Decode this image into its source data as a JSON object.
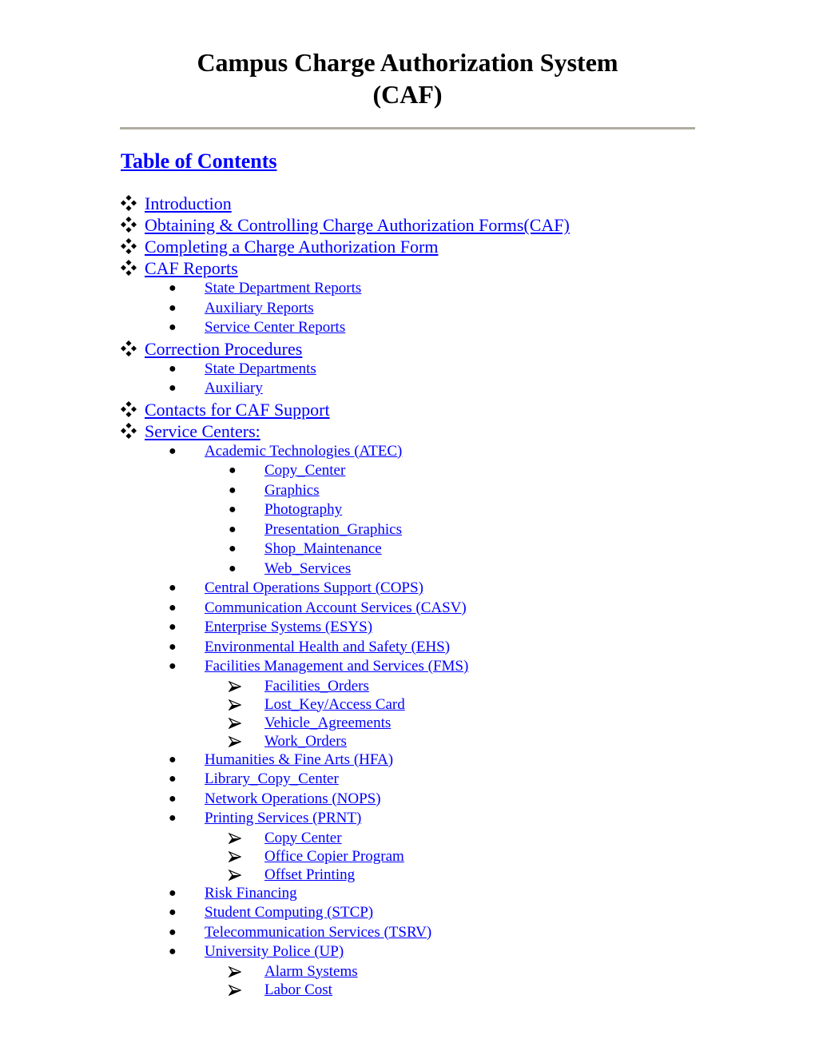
{
  "document": {
    "title_line1": "Campus Charge Authorization System",
    "title_line2": "(CAF)",
    "toc_heading": "Table of Contents"
  },
  "toc": [
    {
      "level": 0,
      "marker": "diamond-bullet",
      "label": "Introduction"
    },
    {
      "level": 0,
      "marker": "diamond-bullet",
      "label": "Obtaining & Controlling Charge Authorization Forms(CAF)"
    },
    {
      "level": 0,
      "marker": "diamond-bullet",
      "label": "Completing a Charge Authorization Form"
    },
    {
      "level": 0,
      "marker": "diamond-bullet",
      "label": "CAF Reports"
    },
    {
      "level": 1,
      "marker": "dot-bullet",
      "label": "State Department Reports"
    },
    {
      "level": 1,
      "marker": "dot-bullet",
      "label": "Auxiliary Reports"
    },
    {
      "level": 1,
      "marker": "dot-bullet",
      "label": "Service Center Reports"
    },
    {
      "level": 0,
      "marker": "diamond-bullet",
      "label": "Correction Procedures"
    },
    {
      "level": 1,
      "marker": "dot-bullet",
      "label": "State Departments"
    },
    {
      "level": 1,
      "marker": "dot-bullet",
      "label": "Auxiliary"
    },
    {
      "level": 0,
      "marker": "diamond-bullet",
      "label": "Contacts for CAF Support"
    },
    {
      "level": 0,
      "marker": "diamond-bullet",
      "label": "Service Centers:"
    },
    {
      "level": 1,
      "marker": "dot-bullet",
      "label": "Academic Technologies (ATEC)"
    },
    {
      "level": 2,
      "marker": "dot-bullet",
      "label": "Copy_Center"
    },
    {
      "level": 2,
      "marker": "dot-bullet",
      "label": "Graphics"
    },
    {
      "level": 2,
      "marker": "dot-bullet",
      "label": "Photography"
    },
    {
      "level": 2,
      "marker": "dot-bullet",
      "label": "Presentation_Graphics"
    },
    {
      "level": 2,
      "marker": "dot-bullet",
      "label": "Shop_Maintenance"
    },
    {
      "level": 2,
      "marker": "dot-bullet",
      "label": "Web_Services"
    },
    {
      "level": 1,
      "marker": "dot-bullet",
      "label": "Central Operations Support (COPS)"
    },
    {
      "level": 1,
      "marker": "dot-bullet",
      "label": "Communication Account Services (CASV)"
    },
    {
      "level": 1,
      "marker": "dot-bullet",
      "label": "Enterprise Systems (ESYS) "
    },
    {
      "level": 1,
      "marker": "dot-bullet",
      "label": "Environmental Health and Safety (EHS)"
    },
    {
      "level": 1,
      "marker": "dot-bullet",
      "label": "Facilities Management and Services (FMS)"
    },
    {
      "level": 3,
      "marker": "arrow-bullet",
      "label": "Facilities_Orders"
    },
    {
      "level": 3,
      "marker": "arrow-bullet",
      "label": "Lost_Key/Access Card"
    },
    {
      "level": 3,
      "marker": "arrow-bullet",
      "label": "Vehicle_Agreements"
    },
    {
      "level": 3,
      "marker": "arrow-bullet",
      "label": "Work_Orders"
    },
    {
      "level": 1,
      "marker": "dot-bullet",
      "label": "Humanities & Fine Arts (HFA)"
    },
    {
      "level": 1,
      "marker": "dot-bullet",
      "label": "Library_Copy_Center"
    },
    {
      "level": 1,
      "marker": "dot-bullet",
      "label": "Network Operations (NOPS)"
    },
    {
      "level": 1,
      "marker": "dot-bullet",
      "label": "Printing Services (PRNT)"
    },
    {
      "level": 3,
      "marker": "arrow-bullet",
      "label": "Copy Center"
    },
    {
      "level": 3,
      "marker": "arrow-bullet",
      "label": "Office Copier Program"
    },
    {
      "level": 3,
      "marker": "arrow-bullet",
      "label": "Offset Printing"
    },
    {
      "level": 1,
      "marker": "dot-bullet",
      "label": "Risk Financing"
    },
    {
      "level": 1,
      "marker": "dot-bullet",
      "label": "Student Computing (STCP)"
    },
    {
      "level": 1,
      "marker": "dot-bullet",
      "label": "Telecommunication Services (TSRV)"
    },
    {
      "level": 1,
      "marker": "dot-bullet",
      "label": "University Police (UP) "
    },
    {
      "level": 3,
      "marker": "arrow-bullet",
      "label": "Alarm Systems"
    },
    {
      "level": 3,
      "marker": "arrow-bullet",
      "label": "Labor Cost"
    }
  ],
  "colors": {
    "link": "#0000ff",
    "rule": "#b1aca0",
    "text": "#000000"
  }
}
